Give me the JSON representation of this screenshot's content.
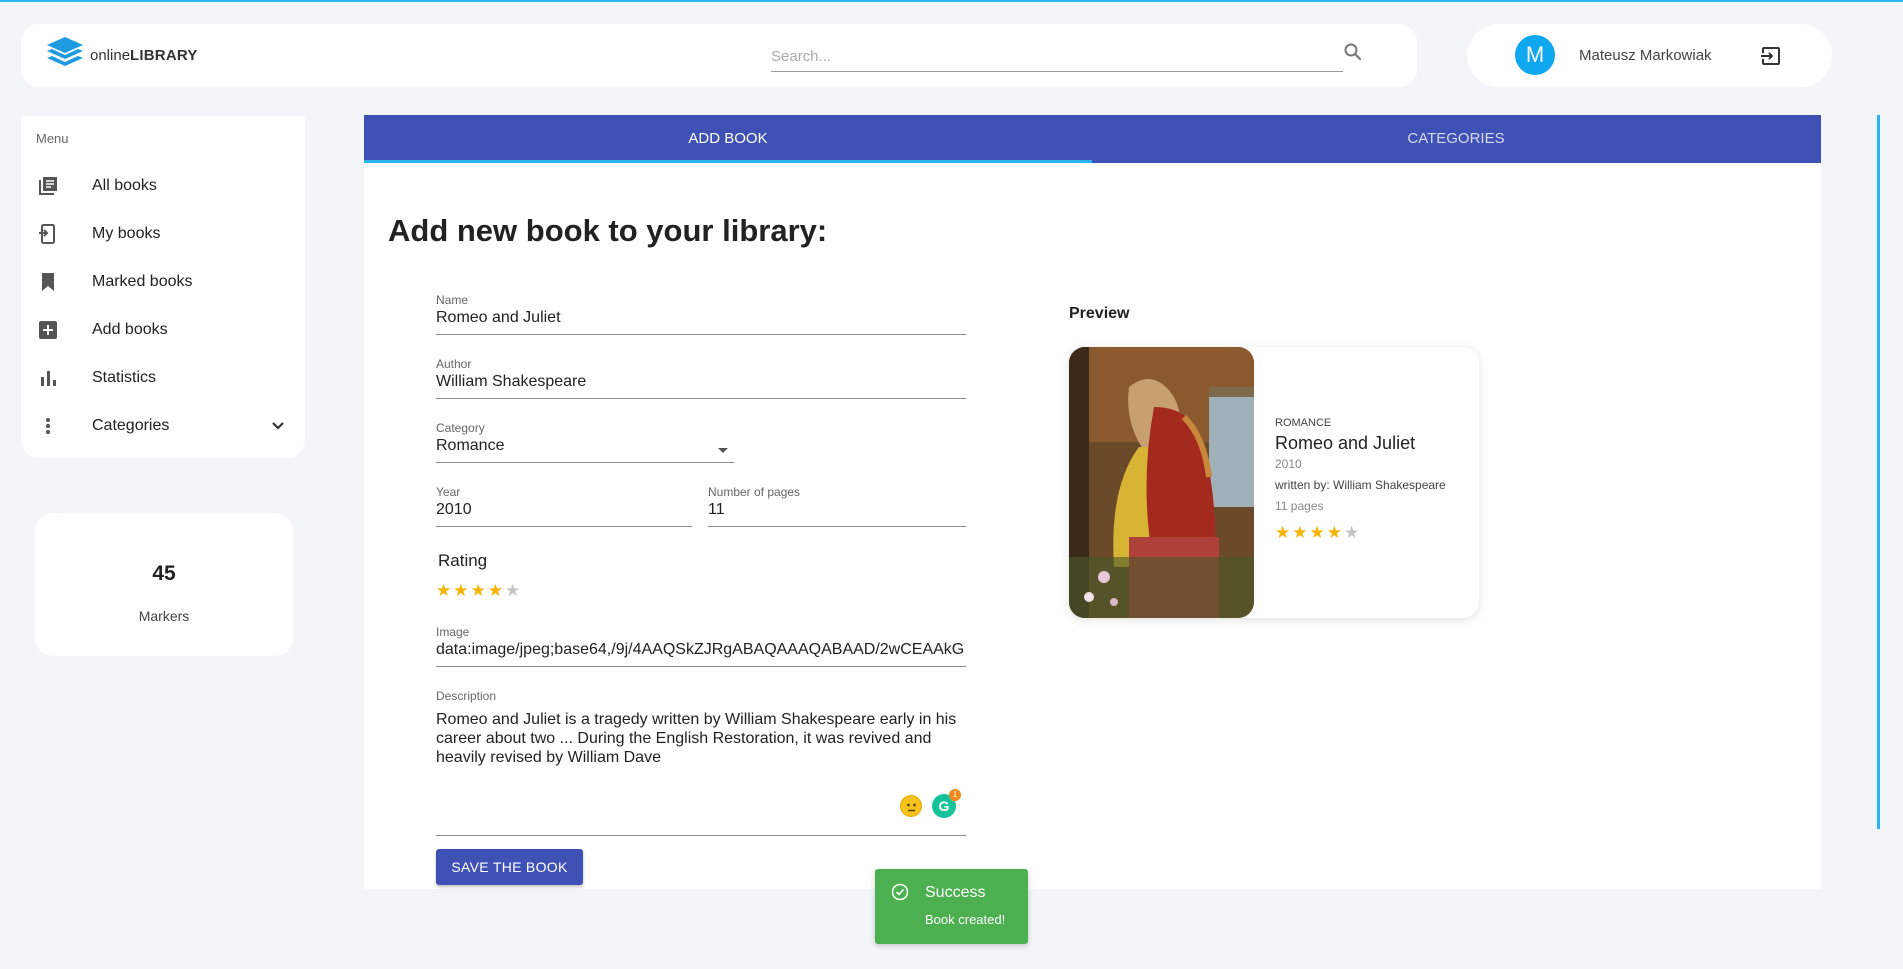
{
  "header": {
    "brand_light": "online",
    "brand_bold": "LIBRARY",
    "search_placeholder": "Search...",
    "user_initial": "M",
    "user_name": "Mateusz Markowiak"
  },
  "sidebar": {
    "menu_title": "Menu",
    "items": [
      {
        "label": "All books",
        "icon": "library-books-icon"
      },
      {
        "label": "My books",
        "icon": "my-books-icon"
      },
      {
        "label": "Marked books",
        "icon": "bookmark-icon"
      },
      {
        "label": "Add books",
        "icon": "add-box-icon"
      },
      {
        "label": "Statistics",
        "icon": "bar-chart-icon"
      },
      {
        "label": "Categories",
        "icon": "more-vert-icon"
      }
    ]
  },
  "markers": {
    "count": "45",
    "label": "Markers"
  },
  "tabs": [
    {
      "label": "ADD BOOK",
      "active": true
    },
    {
      "label": "CATEGORIES",
      "active": false
    }
  ],
  "form": {
    "title": "Add new book to your library:",
    "name_label": "Name",
    "name_value": "Romeo and Juliet",
    "author_label": "Author",
    "author_value": "William Shakespeare",
    "category_label": "Category",
    "category_value": "Romance",
    "year_label": "Year",
    "year_value": "2010",
    "pages_label": "Number of pages",
    "pages_value": "11",
    "rating_label": "Rating",
    "rating": 4,
    "rating_max": 5,
    "image_label": "Image",
    "image_value": "data:image/jpeg;base64,/9j/4AAQSkZJRgABAQAAAQABAAD/2wCEAAkG",
    "description_label": "Description",
    "description_value": "Romeo and Juliet is a tragedy written by William Shakespeare early in his career about two ... During the English Restoration, it was revived and heavily revised by William Dave",
    "grammarly_count": "1",
    "save_label": "SAVE THE BOOK"
  },
  "preview": {
    "label": "Preview",
    "category": "ROMANCE",
    "title": "Romeo and Juliet",
    "year": "2010",
    "author": "written by: William Shakespeare",
    "pages": "11 pages",
    "rating": 4
  },
  "toast": {
    "title": "Success",
    "message": "Book created!"
  },
  "colors": {
    "accent": "#3f51b5",
    "highlight": "#2bb5f0",
    "star": "#f5b400",
    "star_empty": "#c4c4c4",
    "success": "#4caf50"
  }
}
